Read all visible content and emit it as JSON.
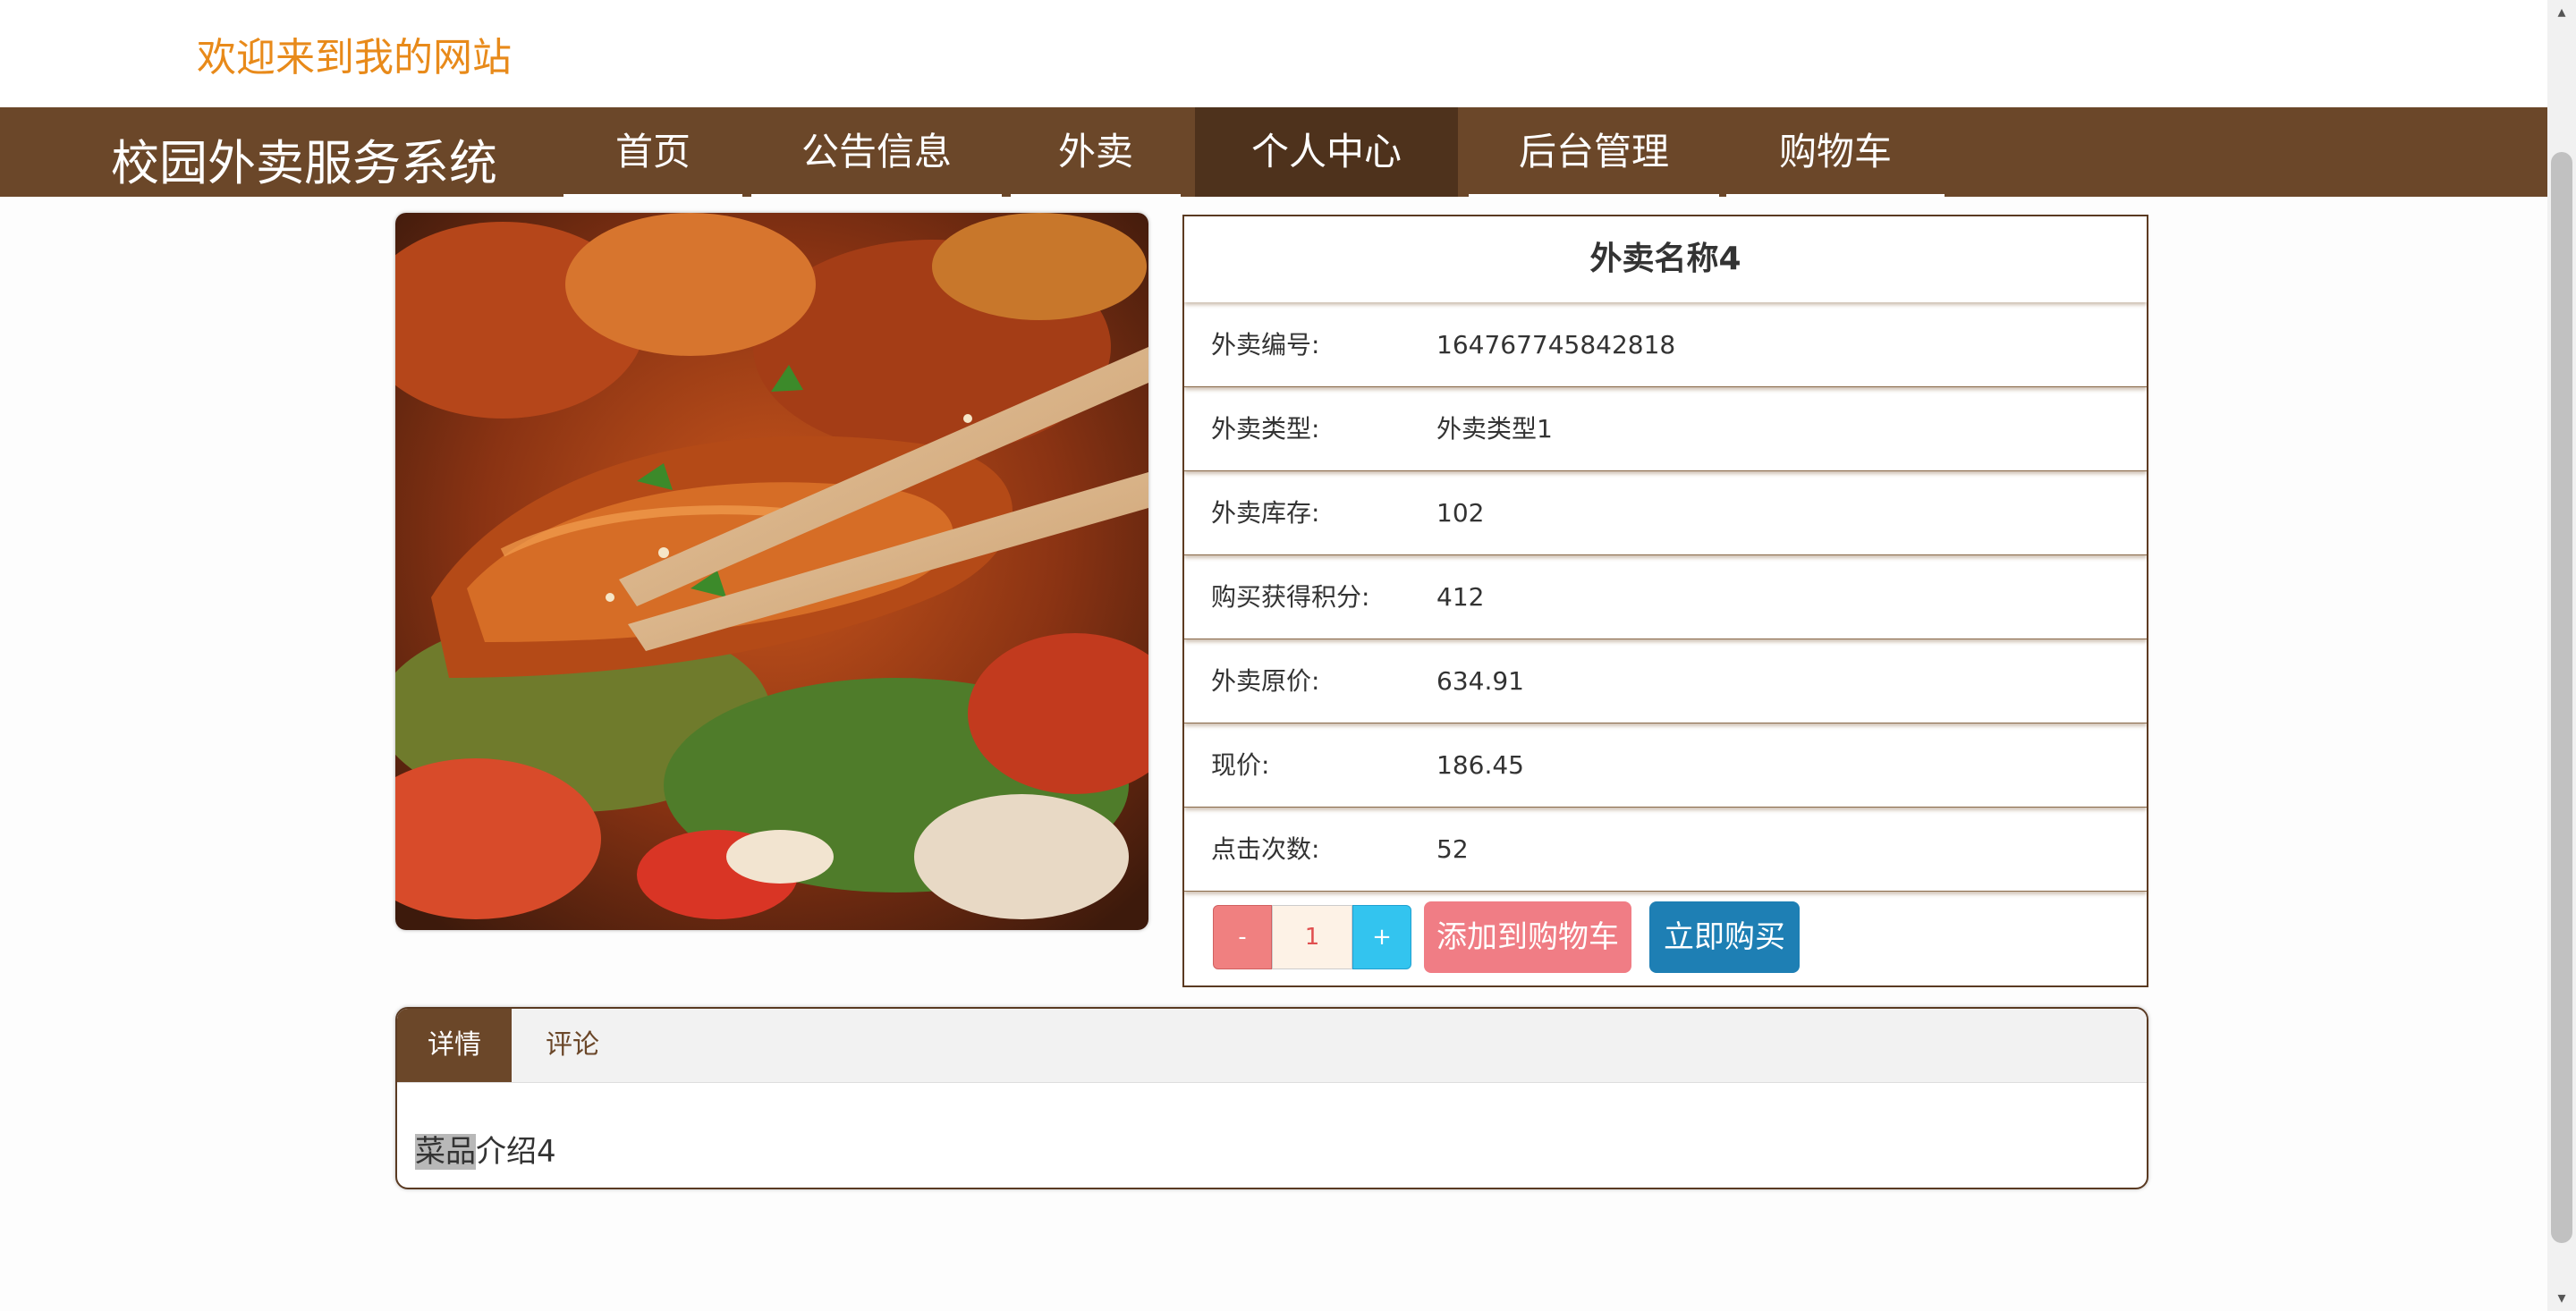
{
  "header": {
    "welcome": "欢迎来到我的网站"
  },
  "nav": {
    "brand": "校园外卖服务系统",
    "items": [
      {
        "label": "首页"
      },
      {
        "label": "公告信息"
      },
      {
        "label": "外卖"
      },
      {
        "label": "个人中心",
        "active": true
      },
      {
        "label": "后台管理"
      },
      {
        "label": "购物车"
      }
    ]
  },
  "product": {
    "title": "外卖名称4",
    "fields": [
      {
        "label": "外卖编号:",
        "value": "164767745842818"
      },
      {
        "label": "外卖类型:",
        "value": "外卖类型1"
      },
      {
        "label": "外卖库存:",
        "value": "102"
      },
      {
        "label": "购买获得积分:",
        "value": "412"
      },
      {
        "label": "外卖原价:",
        "value": "634.91"
      },
      {
        "label": "现价:",
        "value": "186.45"
      },
      {
        "label": "点击次数:",
        "value": "52"
      }
    ],
    "quantity": {
      "minus": "-",
      "value": "1",
      "plus": "+"
    },
    "add_to_cart": "添加到购物车",
    "buy_now": "立即购买"
  },
  "tabs": {
    "items": [
      {
        "label": "详情",
        "active": true
      },
      {
        "label": "评论"
      }
    ],
    "description_highlight": "菜品",
    "description_rest": "介绍4"
  },
  "colors": {
    "accent": "#6b4729",
    "welcome": "#e88a1a",
    "cart_button": "#f07d85",
    "buy_button": "#1e7fb4",
    "plus_button": "#33c4ef"
  }
}
